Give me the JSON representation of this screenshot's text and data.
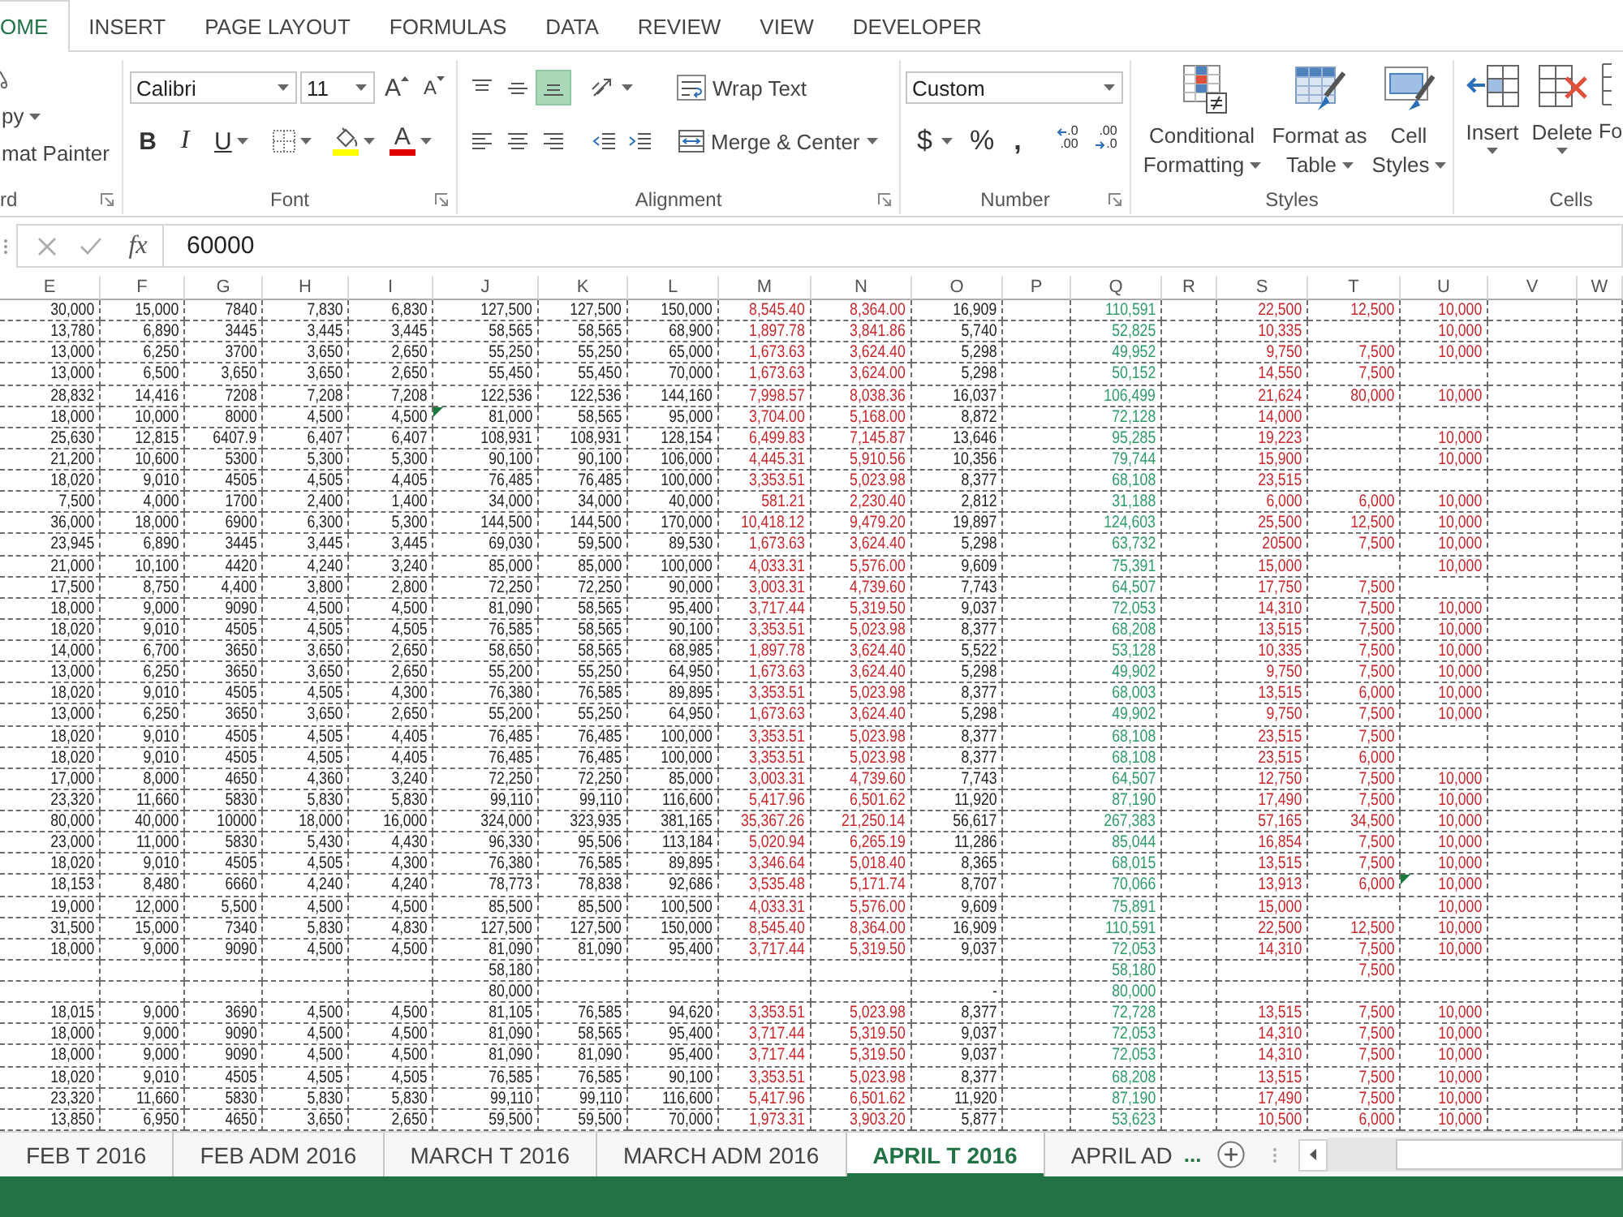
{
  "ribbon": {
    "tabs": [
      {
        "label": "OME",
        "selected": true
      },
      {
        "label": "INSERT",
        "selected": false
      },
      {
        "label": "PAGE LAYOUT",
        "selected": false
      },
      {
        "label": "FORMULAS",
        "selected": false
      },
      {
        "label": "DATA",
        "selected": false
      },
      {
        "label": "REVIEW",
        "selected": false
      },
      {
        "label": "VIEW",
        "selected": false
      },
      {
        "label": "DEVELOPER",
        "selected": false
      }
    ],
    "clipboard": {
      "copy": "py",
      "format_painter": "mat Painter",
      "label": "rd"
    },
    "font": {
      "name": "Calibri",
      "size": "11",
      "grow": "A",
      "shrink": "A",
      "bold": "B",
      "italic": "I",
      "underline": "U",
      "font_color": "A",
      "label": "Font"
    },
    "alignment": {
      "vertical": [
        {
          "kind": "top",
          "selected": false
        },
        {
          "kind": "middle",
          "selected": false
        },
        {
          "kind": "bottom",
          "selected": true
        }
      ],
      "horizontal": [
        {
          "kind": "left",
          "selected": false
        },
        {
          "kind": "center",
          "selected": false
        },
        {
          "kind": "right",
          "selected": false
        }
      ],
      "wrap_text": "Wrap Text",
      "merge": "Merge & Center",
      "label": "Alignment"
    },
    "number": {
      "format": "Custom",
      "currency": "$",
      "percent": "%",
      "comma": ",",
      "increase_decimal": [
        ".0",
        ".00"
      ],
      "decrease_decimal": [
        ".00",
        ".0"
      ],
      "label": "Number"
    },
    "styles": {
      "buttons": [
        {
          "kind": "conditional",
          "lines": [
            "Conditional",
            "Formatting"
          ]
        },
        {
          "kind": "table",
          "lines": [
            "Format as",
            "Table"
          ]
        },
        {
          "kind": "cell",
          "lines": [
            "Cell",
            "Styles"
          ]
        }
      ],
      "label": "Styles"
    },
    "cells": {
      "buttons": [
        {
          "kind": "insert",
          "label": "Insert"
        },
        {
          "kind": "delete",
          "label": "Delete"
        },
        {
          "kind": "format",
          "label": "Fo"
        }
      ],
      "label": "Cells"
    }
  },
  "formula_bar": {
    "function_label": "fx",
    "value": "60000"
  },
  "sheet": {
    "columns": [
      {
        "label": "E",
        "color": "#222222"
      },
      {
        "label": "F",
        "color": "#222222"
      },
      {
        "label": "G",
        "color": "#222222"
      },
      {
        "label": "H",
        "color": "#222222"
      },
      {
        "label": "I",
        "color": "#222222"
      },
      {
        "label": "J",
        "color": "#222222"
      },
      {
        "label": "K",
        "color": "#222222"
      },
      {
        "label": "L",
        "color": "#222222"
      },
      {
        "label": "M",
        "color": "#c8262c"
      },
      {
        "label": "N",
        "color": "#c8262c"
      },
      {
        "label": "O",
        "color": "#222222"
      },
      {
        "label": "P"
      },
      {
        "label": "Q",
        "color": "#2e9b68"
      },
      {
        "label": "R"
      },
      {
        "label": "S",
        "color": "#c8262c"
      },
      {
        "label": "T",
        "color": "#c8262c"
      },
      {
        "label": "U",
        "color": "#c8262c"
      },
      {
        "label": "V"
      },
      {
        "label": "W"
      }
    ],
    "rows": [
      [
        "30,000",
        "15,000",
        "7840",
        "7,830",
        "6,830",
        "127,500",
        "127,500",
        "150,000",
        "8,545.40",
        "8,364.00",
        "16,909",
        null,
        "110,591",
        null,
        "22,500",
        "12,500",
        "10,000"
      ],
      [
        "13,780",
        "6,890",
        "3445",
        "3,445",
        "3,445",
        "58,565",
        "58,565",
        "68,900",
        "1,897.78",
        "3,841.86",
        "5,740",
        null,
        "52,825",
        null,
        "10,335",
        null,
        "10,000"
      ],
      [
        "13,000",
        "6,250",
        "3700",
        "3,650",
        "2,650",
        "55,250",
        "55,250",
        "65,000",
        "1,673.63",
        "3,624.40",
        "5,298",
        null,
        "49,952",
        null,
        "9,750",
        "7,500",
        "10,000"
      ],
      [
        "13,000",
        "6,500",
        "3,650",
        "3,650",
        "2,650",
        "55,450",
        "55,450",
        "70,000",
        "1,673.63",
        "3,624.00",
        "5,298",
        null,
        "50,152",
        null,
        "14,550",
        "7,500",
        null
      ],
      [
        "28,832",
        "14,416",
        "7208",
        "7,208",
        "7,208",
        "122,536",
        "122,536",
        "144,160",
        "7,998.57",
        "8,038.36",
        "16,037",
        null,
        "106,499",
        null,
        "21,624",
        "80,000",
        "10,000"
      ],
      [
        "18,000",
        "10,000",
        "8000",
        "4,500",
        "4,500",
        {
          "text": "81,000",
          "error_mark": true
        },
        "58,565",
        "95,000",
        "3,704.00",
        "5,168.00",
        "8,872",
        null,
        "72,128",
        null,
        "14,000",
        null,
        null
      ],
      [
        "25,630",
        "12,815",
        "6407.9",
        "6,407",
        "6,407",
        "108,931",
        "108,931",
        "128,154",
        "6,499.83",
        "7,145.87",
        "13,646",
        null,
        "95,285",
        null,
        "19,223",
        null,
        "10,000"
      ],
      [
        "21,200",
        "10,600",
        "5300",
        "5,300",
        "5,300",
        "90,100",
        "90,100",
        "106,000",
        "4,445.31",
        "5,910.56",
        "10,356",
        null,
        "79,744",
        null,
        "15,900",
        null,
        "10,000"
      ],
      [
        "18,020",
        "9,010",
        "4505",
        "4,505",
        "4,405",
        "76,485",
        "76,485",
        "100,000",
        "3,353.51",
        "5,023.98",
        "8,377",
        null,
        "68,108",
        null,
        "23,515",
        null,
        null
      ],
      [
        "7,500",
        "4,000",
        "1700",
        "2,400",
        "1,400",
        "34,000",
        "34,000",
        "40,000",
        "581.21",
        "2,230.40",
        "2,812",
        null,
        "31,188",
        null,
        "6,000",
        "6,000",
        "10,000"
      ],
      [
        "36,000",
        "18,000",
        "6900",
        "6,300",
        "5,300",
        "144,500",
        "144,500",
        "170,000",
        "10,418.12",
        "9,479.20",
        "19,897",
        null,
        "124,603",
        null,
        "25,500",
        "12,500",
        "10,000"
      ],
      [
        "23,945",
        "6,890",
        "3445",
        "3,445",
        "3,445",
        "69,030",
        "59,500",
        "89,530",
        "1,673.63",
        "3,624.40",
        "5,298",
        null,
        "63,732",
        null,
        "20500",
        "7,500",
        "10,000"
      ],
      [
        "21,000",
        "10,100",
        "4420",
        "4,240",
        "3,240",
        "85,000",
        "85,000",
        "100,000",
        "4,033.31",
        "5,576.00",
        "9,609",
        null,
        "75,391",
        null,
        "15,000",
        null,
        "10,000"
      ],
      [
        "17,500",
        "8,750",
        "4,400",
        "3,800",
        "2,800",
        "72,250",
        "72,250",
        "90,000",
        "3,003.31",
        "4,739.60",
        "7,743",
        null,
        "64,507",
        null,
        "17,750",
        "7,500",
        null
      ],
      [
        "18,000",
        "9,000",
        "9090",
        "4,500",
        "4,500",
        "81,090",
        "58,565",
        "95,400",
        "3,717.44",
        "5,319.50",
        "9,037",
        null,
        "72,053",
        null,
        "14,310",
        "7,500",
        "10,000"
      ],
      [
        "18,020",
        "9,010",
        "4505",
        "4,505",
        "4,505",
        "76,585",
        "58,565",
        "90,100",
        "3,353.51",
        "5,023.98",
        "8,377",
        null,
        "68,208",
        null,
        "13,515",
        "7,500",
        "10,000"
      ],
      [
        "14,000",
        "6,700",
        "3650",
        "3,650",
        "2,650",
        "58,650",
        "58,565",
        "68,985",
        "1,897.78",
        "3,624.40",
        "5,522",
        null,
        "53,128",
        null,
        "10,335",
        "7,500",
        "10,000"
      ],
      [
        "13,000",
        "6,250",
        "3650",
        "3,650",
        "2,650",
        "55,200",
        "55,250",
        "64,950",
        "1,673.63",
        "3,624.40",
        "5,298",
        null,
        "49,902",
        null,
        "9,750",
        "7,500",
        "10,000"
      ],
      [
        "18,020",
        "9,010",
        "4505",
        "4,505",
        "4,300",
        "76,380",
        "76,585",
        "89,895",
        "3,353.51",
        "5,023.98",
        "8,377",
        null,
        "68,003",
        null,
        "13,515",
        "6,000",
        "10,000"
      ],
      [
        "13,000",
        "6,250",
        "3650",
        "3,650",
        "2,650",
        "55,200",
        "55,250",
        "64,950",
        "1,673.63",
        "3,624.40",
        "5,298",
        null,
        "49,902",
        null,
        "9,750",
        "7,500",
        "10,000"
      ],
      [
        "18,020",
        "9,010",
        "4505",
        "4,505",
        "4,405",
        "76,485",
        "76,485",
        "100,000",
        "3,353.51",
        "5,023.98",
        "8,377",
        null,
        "68,108",
        null,
        "23,515",
        "7,500",
        null
      ],
      [
        "18,020",
        "9,010",
        "4505",
        "4,505",
        "4,405",
        "76,485",
        "76,485",
        "100,000",
        "3,353.51",
        "5,023.98",
        "8,377",
        null,
        "68,108",
        null,
        "23,515",
        "6,000",
        null
      ],
      [
        "17,000",
        "8,000",
        "4650",
        "4,360",
        "3,240",
        "72,250",
        "72,250",
        "85,000",
        "3,003.31",
        "4,739.60",
        "7,743",
        null,
        "64,507",
        null,
        "12,750",
        "7,500",
        "10,000"
      ],
      [
        "23,320",
        "11,660",
        "5830",
        "5,830",
        "5,830",
        "99,110",
        "99,110",
        "116,600",
        "5,417.96",
        "6,501.62",
        "11,920",
        null,
        "87,190",
        null,
        "17,490",
        "7,500",
        "10,000"
      ],
      [
        "80,000",
        "40,000",
        "10000",
        "18,000",
        "16,000",
        "324,000",
        "323,935",
        "381,165",
        "35,367.26",
        "21,250.14",
        "56,617",
        null,
        "267,383",
        null,
        "57,165",
        "34,500",
        "10,000"
      ],
      [
        "23,000",
        "11,000",
        "5830",
        "5,430",
        "4,430",
        "96,330",
        "95,506",
        "113,184",
        "5,020.94",
        "6,265.19",
        "11,286",
        null,
        "85,044",
        null,
        "16,854",
        "7,500",
        "10,000"
      ],
      [
        "18,020",
        "9,010",
        "4505",
        "4,505",
        "4,300",
        "76,380",
        "76,585",
        "89,895",
        "3,346.64",
        "5,018.40",
        "8,365",
        null,
        "68,015",
        null,
        "13,515",
        "7,500",
        "10,000"
      ],
      [
        "18,153",
        "8,480",
        "6660",
        "4,240",
        "4,240",
        "78,773",
        "78,838",
        "92,686",
        "3,535.48",
        "5,171.74",
        "8,707",
        null,
        "70,066",
        null,
        "13,913",
        "6,000",
        {
          "text": "10,000",
          "error_mark": true
        }
      ],
      [
        "19,000",
        "12,000",
        "5,500",
        "4,500",
        "4,500",
        "85,500",
        "85,500",
        "100,500",
        "4,033.31",
        "5,576.00",
        "9,609",
        null,
        "75,891",
        null,
        "15,000",
        null,
        "10,000"
      ],
      [
        "31,500",
        "15,000",
        "7340",
        "5,830",
        "4,830",
        "127,500",
        "127,500",
        "150,000",
        "8,545.40",
        "8,364.00",
        "16,909",
        null,
        "110,591",
        null,
        "22,500",
        "12,500",
        "10,000"
      ],
      [
        "18,000",
        "9,000",
        "9090",
        "4,500",
        "4,500",
        "81,090",
        "81,090",
        "95,400",
        "3,717.44",
        "5,319.50",
        "9,037",
        null,
        "72,053",
        null,
        "14,310",
        "7,500",
        "10,000"
      ],
      [
        null,
        null,
        null,
        null,
        null,
        "58,180",
        null,
        null,
        null,
        null,
        null,
        null,
        "58,180",
        null,
        null,
        "7,500",
        null
      ],
      [
        null,
        null,
        null,
        null,
        null,
        "80,000",
        null,
        null,
        null,
        null,
        "-",
        null,
        "80,000",
        null,
        null,
        null,
        null
      ],
      [
        "18,015",
        "9,000",
        "3690",
        "4,500",
        "4,500",
        "81,105",
        "76,585",
        "94,620",
        "3,353.51",
        "5,023.98",
        "8,377",
        null,
        "72,728",
        null,
        "13,515",
        "7,500",
        "10,000"
      ],
      [
        "18,000",
        "9,000",
        "9090",
        "4,500",
        "4,500",
        "81,090",
        "58,565",
        "95,400",
        "3,717.44",
        "5,319.50",
        "9,037",
        null,
        "72,053",
        null,
        "14,310",
        "7,500",
        "10,000"
      ],
      [
        "18,000",
        "9,000",
        "9090",
        "4,500",
        "4,500",
        "81,090",
        "81,090",
        "95,400",
        "3,717.44",
        "5,319.50",
        "9,037",
        null,
        "72,053",
        null,
        "14,310",
        "7,500",
        "10,000"
      ],
      [
        "18,020",
        "9,010",
        "4505",
        "4,505",
        "4,505",
        "76,585",
        "76,585",
        "90,100",
        "3,353.51",
        "5,023.98",
        "8,377",
        null,
        "68,208",
        null,
        "13,515",
        "7,500",
        "10,000"
      ],
      [
        "23,320",
        "11,660",
        "5830",
        "5,830",
        "5,830",
        "99,110",
        "99,110",
        "116,600",
        "5,417.96",
        "6,501.62",
        "11,920",
        null,
        "87,190",
        null,
        "17,490",
        "7,500",
        "10,000"
      ],
      [
        "13,850",
        "6,950",
        "4650",
        "3,650",
        "2,650",
        "59,500",
        "59,500",
        "70,000",
        "1,973.31",
        "3,903.20",
        "5,877",
        null,
        "53,623",
        null,
        "10,500",
        "6,000",
        "10,000"
      ]
    ]
  },
  "sheet_tabs": {
    "tabs": [
      {
        "label": "FEB T 2016",
        "selected": false
      },
      {
        "label": "FEB ADM 2016",
        "selected": false
      },
      {
        "label": "MARCH T 2016",
        "selected": false
      },
      {
        "label": "MARCH ADM 2016",
        "selected": false
      },
      {
        "label": "APRIL T 2016",
        "selected": true
      },
      {
        "label": "APRIL AD",
        "selected": false
      }
    ],
    "more": "..."
  }
}
